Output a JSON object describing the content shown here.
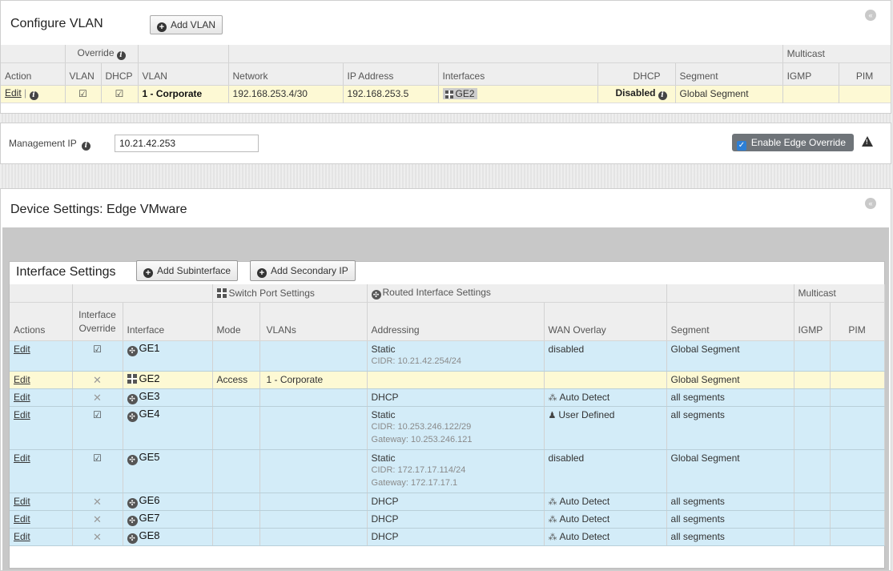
{
  "vlan_panel": {
    "title": "Configure VLAN",
    "add_button": "Add VLAN",
    "collapse_glyph": "«",
    "group_override": "Override",
    "group_multicast": "Multicast",
    "columns": [
      "Action",
      "VLAN",
      "DHCP",
      "VLAN",
      "Network",
      "IP Address",
      "Interfaces",
      "DHCP",
      "Segment",
      "IGMP",
      "PIM"
    ],
    "row": {
      "edit": "Edit",
      "separator": "|",
      "vlan": "1 - Corporate",
      "network": "192.168.253.4/30",
      "ip": "192.168.253.5",
      "interface": "GE2",
      "dhcp": "Disabled",
      "segment": "Global Segment"
    }
  },
  "management": {
    "label": "Management IP",
    "value": "10.21.42.253",
    "override_label": "Enable Edge Override",
    "override_checked": true,
    "warning_glyph": "!"
  },
  "device_panel": {
    "title": "Device Settings: Edge VMware",
    "collapse_glyph": "«"
  },
  "interface_settings": {
    "title": "Interface Settings",
    "add_subinterface": "Add Subinterface",
    "add_secondary_ip": "Add Secondary IP",
    "group_switch": "Switch Port Settings",
    "group_routed": "Routed Interface Settings",
    "group_multicast": "Multicast",
    "col_override_top": "Interface",
    "col_override_bottom": "Override",
    "columns": [
      "Actions",
      "Interface",
      "Mode",
      "VLANs",
      "Addressing",
      "WAN Overlay",
      "Segment",
      "IGMP",
      "PIM"
    ],
    "rows": [
      {
        "edit": "Edit",
        "override": "check",
        "kind": "routed",
        "name": "GE1",
        "mode": "",
        "vlans": "",
        "addressing": "Static",
        "details": [
          "CIDR: 10.21.42.254/24"
        ],
        "wan": "disabled",
        "wan_icon": "",
        "segment": "Global Segment",
        "highlight": "blue"
      },
      {
        "edit": "Edit",
        "override": "x",
        "kind": "switch",
        "name": "GE2",
        "mode": "Access",
        "vlans": "1 - Corporate",
        "addressing": "",
        "details": [],
        "wan": "",
        "wan_icon": "",
        "segment": "Global Segment",
        "highlight": "yellow"
      },
      {
        "edit": "Edit",
        "override": "x",
        "kind": "routed",
        "name": "GE3",
        "mode": "",
        "vlans": "",
        "addressing": "DHCP",
        "details": [],
        "wan": "Auto Detect",
        "wan_icon": "auto-detect",
        "segment": "all segments",
        "highlight": "blue"
      },
      {
        "edit": "Edit",
        "override": "check",
        "kind": "routed",
        "name": "GE4",
        "mode": "",
        "vlans": "",
        "addressing": "Static",
        "details": [
          "CIDR: 10.253.246.122/29",
          "Gateway: 10.253.246.121"
        ],
        "wan": "User Defined",
        "wan_icon": "user-defined",
        "segment": "all segments",
        "highlight": "blue"
      },
      {
        "edit": "Edit",
        "override": "check",
        "kind": "routed",
        "name": "GE5",
        "mode": "",
        "vlans": "",
        "addressing": "Static",
        "details": [
          "CIDR: 172.17.17.114/24",
          "Gateway: 172.17.17.1"
        ],
        "wan": "disabled",
        "wan_icon": "",
        "segment": "Global Segment",
        "highlight": "blue"
      },
      {
        "edit": "Edit",
        "override": "x",
        "kind": "routed",
        "name": "GE6",
        "mode": "",
        "vlans": "",
        "addressing": "DHCP",
        "details": [],
        "wan": "Auto Detect",
        "wan_icon": "auto-detect",
        "segment": "all segments",
        "highlight": "blue"
      },
      {
        "edit": "Edit",
        "override": "x",
        "kind": "routed",
        "name": "GE7",
        "mode": "",
        "vlans": "",
        "addressing": "DHCP",
        "details": [],
        "wan": "Auto Detect",
        "wan_icon": "auto-detect",
        "segment": "all segments",
        "highlight": "blue"
      },
      {
        "edit": "Edit",
        "override": "x",
        "kind": "routed",
        "name": "GE8",
        "mode": "",
        "vlans": "",
        "addressing": "DHCP",
        "details": [],
        "wan": "Auto Detect",
        "wan_icon": "auto-detect",
        "segment": "all segments",
        "highlight": "blue"
      }
    ]
  },
  "colors": {
    "selected_row": "#fdf9d4",
    "interface_row": "#d3ecf8",
    "toggle_bg": "#6f7479",
    "checkbox_blue": "#2d7fd6"
  }
}
